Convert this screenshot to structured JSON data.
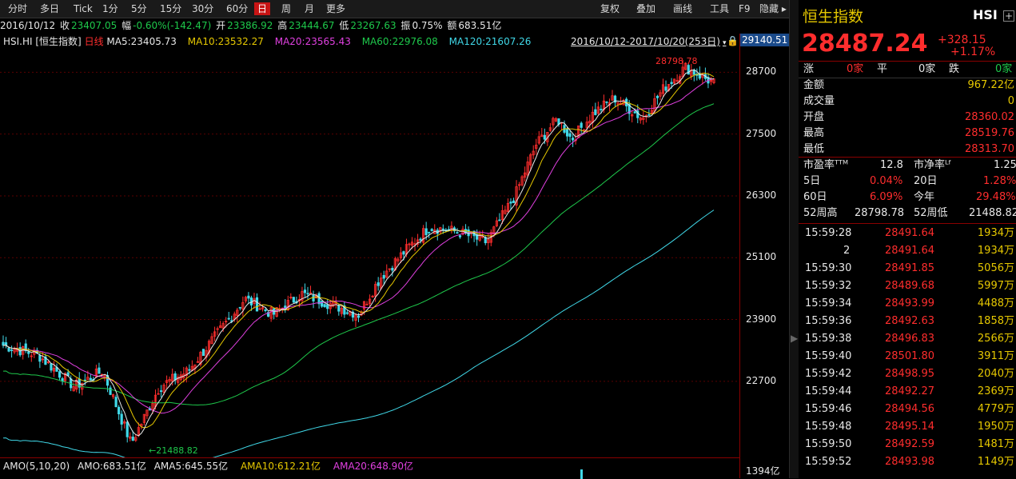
{
  "toolbar": {
    "left_items": [
      "分时",
      "多日",
      "Tick",
      "1分",
      "5分",
      "15分",
      "30分",
      "60分",
      "日",
      "周",
      "月",
      "更多"
    ],
    "active": "日",
    "right_items": [
      "复权",
      "叠加",
      "画线",
      "工具",
      "F9",
      "隐藏"
    ]
  },
  "info": {
    "date": "2016/10/12",
    "close_label": "收",
    "close": "23407.05",
    "change_label": "幅",
    "change": "-0.60%(-142.47)",
    "open_label": "开",
    "open": "23386.92",
    "high_label": "高",
    "high": "23444.67",
    "low_label": "低",
    "low": "23267.63",
    "amp_label": "振",
    "amp": "0.75%",
    "amount_label": "额",
    "amount": "683.51亿"
  },
  "legend": {
    "symbol": "HSI.HI [恒生指数]",
    "period": "日线",
    "ma5": "MA5:23405.73",
    "ma10": "MA10:23532.27",
    "ma20": "MA20:23565.43",
    "ma60": "MA60:22976.08",
    "ma120": "MA120:21607.26",
    "range": "2016/10/12-2017/10/20(253日)"
  },
  "annotations": {
    "high_label": "28798.78",
    "low_label": "←21488.82"
  },
  "axis": {
    "top_value": "29140.51",
    "ticks": [
      "28700",
      "27500",
      "26300",
      "25100",
      "23900",
      "22700"
    ],
    "volume_tick": "1394亿"
  },
  "volume_bar": {
    "amo": "AMO(5,10,20)",
    "amo_val": "AMO:683.51亿",
    "ama5": "AMA5:645.55亿",
    "ama10": "AMA10:612.21亿",
    "ama20": "AMA20:648.90亿"
  },
  "quote": {
    "name": "恒生指数",
    "code": "HSI",
    "price": "28487.24",
    "change": "+328.15",
    "change_pct": "+1.17%",
    "up_label": "涨",
    "up_val": "0家",
    "flat_label": "平",
    "flat_val": "0家",
    "down_label": "跌",
    "down_val": "0家",
    "stats": [
      {
        "label": "金额",
        "value": "967.22亿",
        "color": "yellow"
      },
      {
        "label": "成交量",
        "value": "0",
        "color": "yellow"
      },
      {
        "label": "开盘",
        "value": "28360.02",
        "color": "red"
      },
      {
        "label": "最高",
        "value": "28519.76",
        "color": "red"
      },
      {
        "label": "最低",
        "value": "28313.70",
        "color": "red"
      }
    ],
    "pe_label": "市盈率ᵀᵀᴹ",
    "pe": "12.8",
    "pb_label": "市净率ᴸᶠ",
    "pb": "1.25",
    "d5_label": "5日",
    "d5": "0.04%",
    "d20_label": "20日",
    "d20": "1.28%",
    "d60_label": "60日",
    "d60": "6.09%",
    "ytd_label": "今年",
    "ytd": "29.48%",
    "w52h_label": "52周高",
    "w52h": "28798.78",
    "w52l_label": "52周低",
    "w52l": "21488.82"
  },
  "ticks": [
    {
      "time": "15:59:28",
      "price": "28491.64",
      "vol": "1934万"
    },
    {
      "time": "2",
      "price": "28491.64",
      "vol": "1934万"
    },
    {
      "time": "15:59:30",
      "price": "28491.85",
      "vol": "5056万"
    },
    {
      "time": "15:59:32",
      "price": "28489.68",
      "vol": "5997万"
    },
    {
      "time": "15:59:34",
      "price": "28493.99",
      "vol": "4488万"
    },
    {
      "time": "15:59:36",
      "price": "28492.63",
      "vol": "1858万"
    },
    {
      "time": "15:59:38",
      "price": "28496.83",
      "vol": "2566万"
    },
    {
      "time": "15:59:40",
      "price": "28501.80",
      "vol": "3911万"
    },
    {
      "time": "15:59:42",
      "price": "28498.95",
      "vol": "2040万"
    },
    {
      "time": "15:59:44",
      "price": "28492.27",
      "vol": "2369万"
    },
    {
      "time": "15:59:46",
      "price": "28494.56",
      "vol": "4779万"
    },
    {
      "time": "15:59:48",
      "price": "28495.14",
      "vol": "1950万"
    },
    {
      "time": "15:59:50",
      "price": "28492.59",
      "vol": "1481万"
    },
    {
      "time": "15:59:52",
      "price": "28493.98",
      "vol": "1149万"
    }
  ],
  "chart_data": {
    "type": "line",
    "series": [
      {
        "name": "MA120",
        "color": "#40d8e8",
        "values": [
          21607.26
        ]
      },
      {
        "name": "MA60",
        "color": "#1ec84b",
        "values": [
          22976.08
        ]
      },
      {
        "name": "MA20",
        "color": "#e040e0",
        "values": [
          23565.43
        ]
      },
      {
        "name": "MA10",
        "color": "#e6c800",
        "values": [
          23532.27
        ]
      },
      {
        "name": "MA5",
        "color": "#e8e8e8",
        "values": [
          23405.73
        ]
      }
    ],
    "high": 28798.78,
    "low": 21488.82,
    "ylim": [
      21300,
      29140.51
    ],
    "up_color": "#ff2d2d",
    "down_color": "#40d8e8"
  }
}
